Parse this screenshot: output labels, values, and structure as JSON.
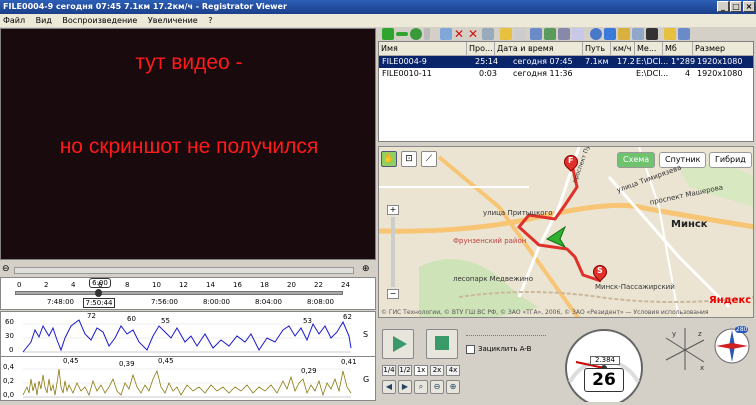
{
  "window": {
    "title": "FILE0004-9   сегодня 07:45   7.1км   17.2км/ч - Registrator Viewer",
    "min": "_",
    "max": "□",
    "close": "×"
  },
  "menu": [
    "Файл",
    "Вид",
    "Воспроизведение",
    "Увеличение",
    "?"
  ],
  "video": {
    "line1": "тут видео -",
    "line2": "но скриншот не получился"
  },
  "timeline": {
    "current": "6:00",
    "minute_ticks": [
      "0",
      "2",
      "4",
      "6",
      "8",
      "10",
      "12",
      "14",
      "16",
      "18",
      "20",
      "22",
      "24"
    ],
    "clock_ticks": [
      "7:48:00",
      "7:52:00",
      "7:56:00",
      "8:00:00",
      "8:04:00",
      "8:08:00"
    ],
    "cursor_time": "7:50:44"
  },
  "graphs": {
    "speed": {
      "axis": "S",
      "y_ticks": [
        "60",
        "30",
        "0"
      ],
      "peaks": [
        "72",
        "60",
        "55",
        "53",
        "62"
      ],
      "color": "#1a1acc"
    },
    "gforce": {
      "axis": "G",
      "y_ticks": [
        "0,4",
        "0,2",
        "0,0"
      ],
      "peaks": [
        "0,45",
        "0,39",
        "0,45",
        "0,29",
        "0,41"
      ],
      "color": "#8a7a10"
    }
  },
  "filelist": {
    "columns": [
      "Имя",
      "Про...",
      "Дата и время",
      "Путь",
      "км/ч",
      "Ме...",
      "Мб",
      "Размер"
    ],
    "rows": [
      {
        "name": "FILE0004-9",
        "dur": "25:14",
        "date": "сегодня 07:45",
        "path": "7.1км",
        "kmh": "17.2",
        "media": "E:\\DCI...",
        "mb": "1\"289",
        "size": "1920x1080",
        "selected": true
      },
      {
        "name": "FILE0010-11",
        "dur": "0:03",
        "date": "сегодня 11:36",
        "path": "",
        "kmh": "",
        "media": "E:\\DCI...",
        "mb": "4",
        "size": "1920x1080",
        "selected": false
      }
    ]
  },
  "map": {
    "modes": [
      "Схема",
      "Спутник",
      "Гибрид"
    ],
    "labels": {
      "street1": "улица Притыцкого",
      "street2": "улица Тимирязева",
      "street3": "проспект Машерова",
      "street4": "проспект Пушкина",
      "district": "Фрунзенский район",
      "park": "лесопарк Медвежино",
      "city": "Минск",
      "station": "Минск-Пассажирский",
      "copyright": "© ГИС Технологии, © ВТУ ГШ ВС РФ, © ЗАО «ТГА», 2006, © ЗАО «Резидент» — Условия использования",
      "brand": "Яндекс"
    },
    "start_marker": "S",
    "finish_marker": "F"
  },
  "controls": {
    "loop_label": "Зациклить A-B",
    "speeds": [
      "1/4",
      "1/2",
      "1x",
      "2x",
      "4x"
    ],
    "odometer": "2.384",
    "speed_value": "26",
    "compass_label": "280"
  }
}
